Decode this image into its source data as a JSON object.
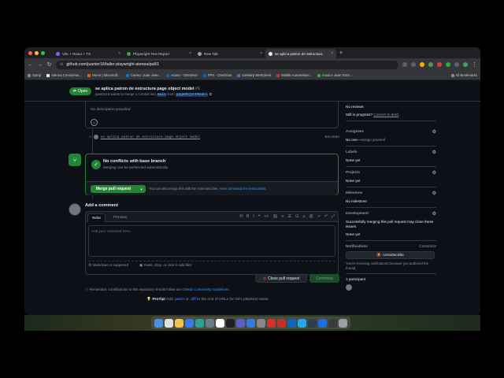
{
  "browser": {
    "tabs": [
      {
        "label": "Vite + React + TS",
        "color": "#8b5cf6"
      },
      {
        "label": "Playwright Test Report",
        "color": "#2ead33"
      },
      {
        "label": "New Tab",
        "color": "#9aa0a6"
      },
      {
        "label": "se aplica patron de estructura",
        "color": "#e6edf3"
      }
    ],
    "new_tab": "+",
    "url": "github.com/juantor16/taller-playwright-atenea/pull/1",
    "bookmarks": [
      "Symp",
      "Atenea Conocimie...",
      "Home | Microsoft...",
      "Correo: Juan Jose...",
      "Home - OneDrive",
      "FPH - OneDrive",
      "IceWarp WebClient",
      "Middle Automation...",
      "Invoice Juan Torre..."
    ],
    "all_bookmarks": "All Bookmarks"
  },
  "pr": {
    "state": "Open",
    "title": "se aplica patron de estructura page object model",
    "number": "#1",
    "subtitle_prefix": "juantor16 wants to merge 1 commit into",
    "base_branch": "main",
    "from": "from",
    "head_branch": "pageObjectModel"
  },
  "description": {
    "empty": "No description provided."
  },
  "commit": {
    "message": "se aplica patron de estructura page object model",
    "sha": "94ce52e"
  },
  "merge": {
    "title": "No conflicts with base branch",
    "subtitle": "Merging can be performed automatically.",
    "button": "Merge pull request",
    "hint_prefix": "You can also merge this with the command line.",
    "hint_link": "View command line instructions."
  },
  "comment": {
    "heading": "Add a comment",
    "tab_write": "Write",
    "tab_preview": "Preview",
    "placeholder": "Add your comment here...",
    "markdown": "Markdown is supported",
    "paste": "Paste, drop, or click to add files",
    "close_button": "Close pull request",
    "comment_button": "Comment"
  },
  "footer": {
    "remember_prefix": "Remember, contributions to this repository should follow our",
    "remember_link": "GitHub Community Guidelines",
    "protip_label": "ProTip!",
    "protip_text_1": "Add",
    "protip_link_1": ".patch",
    "protip_or": "or",
    "protip_link_2": ".diff",
    "protip_text_2": "to the end of URLs for Git's plaintext views."
  },
  "sidebar": {
    "reviews_value": "No reviews",
    "still_progress": "Still in progress?",
    "convert_draft": "Convert to draft",
    "assignees": "Assignees",
    "assignees_value": "No one—",
    "assign_yourself": "assign yourself",
    "labels": "Labels",
    "labels_value": "None yet",
    "projects": "Projects",
    "projects_value": "None yet",
    "milestone": "Milestone",
    "milestone_value": "No milestone",
    "development": "Development",
    "development_text": "Successfully merging this pull request may close these issues.",
    "development_value": "None yet",
    "notifications": "Notifications",
    "customize": "Customize",
    "unsubscribe": "Unsubscribe",
    "notif_text": "You're receiving notifications because you authored the thread.",
    "participants": "1 participant"
  },
  "colors": {
    "accent_green": "#238636",
    "link_blue": "#4493f8",
    "bg": "#0d1117"
  }
}
